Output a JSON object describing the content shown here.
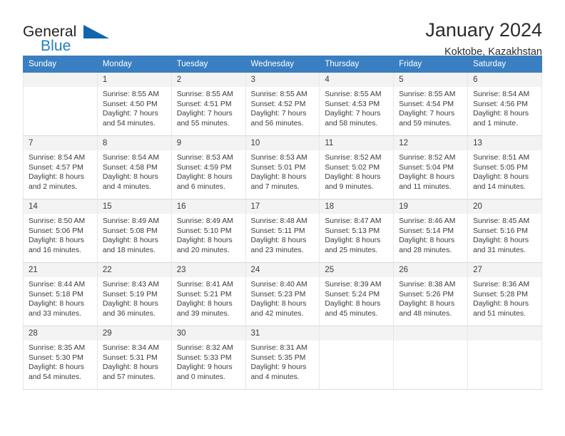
{
  "brand": {
    "name_top": "General",
    "name_bottom": "Blue",
    "triangle_color": "#1265ab",
    "blue_color": "#1f7ec2"
  },
  "header": {
    "title": "January 2024",
    "subtitle": "Koktobe, Kazakhstan"
  },
  "theme": {
    "header_bg": "#3a7fc1",
    "header_text": "#ffffff",
    "daynum_bg": "#f3f3f3",
    "body_text": "#3b3b3b"
  },
  "weekdays": [
    "Sunday",
    "Monday",
    "Tuesday",
    "Wednesday",
    "Thursday",
    "Friday",
    "Saturday"
  ],
  "labels": {
    "sunrise": "Sunrise:",
    "sunset": "Sunset:",
    "daylight": "Daylight:"
  },
  "weeks": [
    [
      {
        "day": "",
        "blank": true
      },
      {
        "day": "1",
        "sunrise": "Sunrise: 8:55 AM",
        "sunset": "Sunset: 4:50 PM",
        "daylight1": "Daylight: 7 hours",
        "daylight2": "and 54 minutes."
      },
      {
        "day": "2",
        "sunrise": "Sunrise: 8:55 AM",
        "sunset": "Sunset: 4:51 PM",
        "daylight1": "Daylight: 7 hours",
        "daylight2": "and 55 minutes."
      },
      {
        "day": "3",
        "sunrise": "Sunrise: 8:55 AM",
        "sunset": "Sunset: 4:52 PM",
        "daylight1": "Daylight: 7 hours",
        "daylight2": "and 56 minutes."
      },
      {
        "day": "4",
        "sunrise": "Sunrise: 8:55 AM",
        "sunset": "Sunset: 4:53 PM",
        "daylight1": "Daylight: 7 hours",
        "daylight2": "and 58 minutes."
      },
      {
        "day": "5",
        "sunrise": "Sunrise: 8:55 AM",
        "sunset": "Sunset: 4:54 PM",
        "daylight1": "Daylight: 7 hours",
        "daylight2": "and 59 minutes."
      },
      {
        "day": "6",
        "sunrise": "Sunrise: 8:54 AM",
        "sunset": "Sunset: 4:56 PM",
        "daylight1": "Daylight: 8 hours",
        "daylight2": "and 1 minute."
      }
    ],
    [
      {
        "day": "7",
        "sunrise": "Sunrise: 8:54 AM",
        "sunset": "Sunset: 4:57 PM",
        "daylight1": "Daylight: 8 hours",
        "daylight2": "and 2 minutes."
      },
      {
        "day": "8",
        "sunrise": "Sunrise: 8:54 AM",
        "sunset": "Sunset: 4:58 PM",
        "daylight1": "Daylight: 8 hours",
        "daylight2": "and 4 minutes."
      },
      {
        "day": "9",
        "sunrise": "Sunrise: 8:53 AM",
        "sunset": "Sunset: 4:59 PM",
        "daylight1": "Daylight: 8 hours",
        "daylight2": "and 6 minutes."
      },
      {
        "day": "10",
        "sunrise": "Sunrise: 8:53 AM",
        "sunset": "Sunset: 5:01 PM",
        "daylight1": "Daylight: 8 hours",
        "daylight2": "and 7 minutes."
      },
      {
        "day": "11",
        "sunrise": "Sunrise: 8:52 AM",
        "sunset": "Sunset: 5:02 PM",
        "daylight1": "Daylight: 8 hours",
        "daylight2": "and 9 minutes."
      },
      {
        "day": "12",
        "sunrise": "Sunrise: 8:52 AM",
        "sunset": "Sunset: 5:04 PM",
        "daylight1": "Daylight: 8 hours",
        "daylight2": "and 11 minutes."
      },
      {
        "day": "13",
        "sunrise": "Sunrise: 8:51 AM",
        "sunset": "Sunset: 5:05 PM",
        "daylight1": "Daylight: 8 hours",
        "daylight2": "and 14 minutes."
      }
    ],
    [
      {
        "day": "14",
        "sunrise": "Sunrise: 8:50 AM",
        "sunset": "Sunset: 5:06 PM",
        "daylight1": "Daylight: 8 hours",
        "daylight2": "and 16 minutes."
      },
      {
        "day": "15",
        "sunrise": "Sunrise: 8:49 AM",
        "sunset": "Sunset: 5:08 PM",
        "daylight1": "Daylight: 8 hours",
        "daylight2": "and 18 minutes."
      },
      {
        "day": "16",
        "sunrise": "Sunrise: 8:49 AM",
        "sunset": "Sunset: 5:10 PM",
        "daylight1": "Daylight: 8 hours",
        "daylight2": "and 20 minutes."
      },
      {
        "day": "17",
        "sunrise": "Sunrise: 8:48 AM",
        "sunset": "Sunset: 5:11 PM",
        "daylight1": "Daylight: 8 hours",
        "daylight2": "and 23 minutes."
      },
      {
        "day": "18",
        "sunrise": "Sunrise: 8:47 AM",
        "sunset": "Sunset: 5:13 PM",
        "daylight1": "Daylight: 8 hours",
        "daylight2": "and 25 minutes."
      },
      {
        "day": "19",
        "sunrise": "Sunrise: 8:46 AM",
        "sunset": "Sunset: 5:14 PM",
        "daylight1": "Daylight: 8 hours",
        "daylight2": "and 28 minutes."
      },
      {
        "day": "20",
        "sunrise": "Sunrise: 8:45 AM",
        "sunset": "Sunset: 5:16 PM",
        "daylight1": "Daylight: 8 hours",
        "daylight2": "and 31 minutes."
      }
    ],
    [
      {
        "day": "21",
        "sunrise": "Sunrise: 8:44 AM",
        "sunset": "Sunset: 5:18 PM",
        "daylight1": "Daylight: 8 hours",
        "daylight2": "and 33 minutes."
      },
      {
        "day": "22",
        "sunrise": "Sunrise: 8:43 AM",
        "sunset": "Sunset: 5:19 PM",
        "daylight1": "Daylight: 8 hours",
        "daylight2": "and 36 minutes."
      },
      {
        "day": "23",
        "sunrise": "Sunrise: 8:41 AM",
        "sunset": "Sunset: 5:21 PM",
        "daylight1": "Daylight: 8 hours",
        "daylight2": "and 39 minutes."
      },
      {
        "day": "24",
        "sunrise": "Sunrise: 8:40 AM",
        "sunset": "Sunset: 5:23 PM",
        "daylight1": "Daylight: 8 hours",
        "daylight2": "and 42 minutes."
      },
      {
        "day": "25",
        "sunrise": "Sunrise: 8:39 AM",
        "sunset": "Sunset: 5:24 PM",
        "daylight1": "Daylight: 8 hours",
        "daylight2": "and 45 minutes."
      },
      {
        "day": "26",
        "sunrise": "Sunrise: 8:38 AM",
        "sunset": "Sunset: 5:26 PM",
        "daylight1": "Daylight: 8 hours",
        "daylight2": "and 48 minutes."
      },
      {
        "day": "27",
        "sunrise": "Sunrise: 8:36 AM",
        "sunset": "Sunset: 5:28 PM",
        "daylight1": "Daylight: 8 hours",
        "daylight2": "and 51 minutes."
      }
    ],
    [
      {
        "day": "28",
        "sunrise": "Sunrise: 8:35 AM",
        "sunset": "Sunset: 5:30 PM",
        "daylight1": "Daylight: 8 hours",
        "daylight2": "and 54 minutes."
      },
      {
        "day": "29",
        "sunrise": "Sunrise: 8:34 AM",
        "sunset": "Sunset: 5:31 PM",
        "daylight1": "Daylight: 8 hours",
        "daylight2": "and 57 minutes."
      },
      {
        "day": "30",
        "sunrise": "Sunrise: 8:32 AM",
        "sunset": "Sunset: 5:33 PM",
        "daylight1": "Daylight: 9 hours",
        "daylight2": "and 0 minutes."
      },
      {
        "day": "31",
        "sunrise": "Sunrise: 8:31 AM",
        "sunset": "Sunset: 5:35 PM",
        "daylight1": "Daylight: 9 hours",
        "daylight2": "and 4 minutes."
      },
      {
        "day": "",
        "blank": true
      },
      {
        "day": "",
        "blank": true
      },
      {
        "day": "",
        "blank": true
      }
    ]
  ]
}
